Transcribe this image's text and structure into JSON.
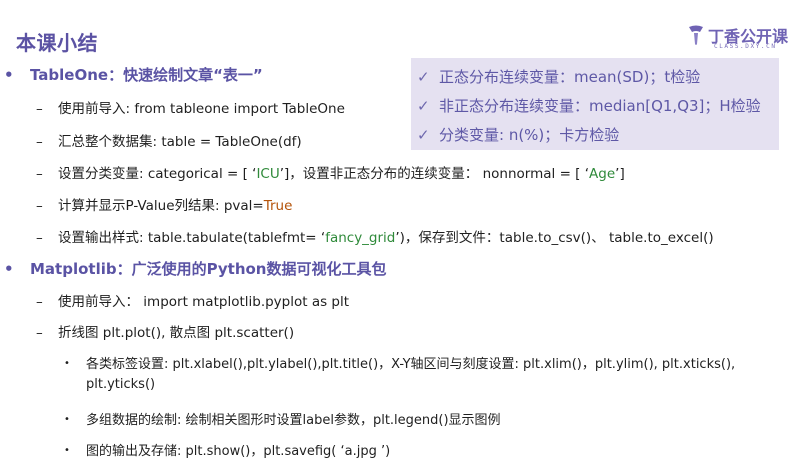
{
  "title": "本课小结",
  "logo": {
    "name": "丁香公开课",
    "sub": "CLASS.DXY.CN"
  },
  "highlight_box": [
    {
      "check": "✓",
      "text": "正态分布连续变量：mean(SD)；t检验"
    },
    {
      "check": "✓",
      "text": "非正态分布连续变量：median[Q1,Q3]；H检验"
    },
    {
      "check": "✓",
      "text": "分类变量: n(%)；卡方检验"
    }
  ],
  "section1": {
    "bullet": "•",
    "title": "TableOne：快速绘制文章“表一”",
    "items": {
      "import": "使用前导入: from tableone import TableOne",
      "summary": "汇总整个数据集: table = TableOne(df)",
      "categorical_prefix": "设置分类变量: categorical = [ ‘",
      "categorical_value": "ICU",
      "categorical_mid": "’]，设置非正态分布的连续变量： nonnormal = [ ‘",
      "nonnormal_value": "Age",
      "nonnormal_suffix": "’]",
      "pval_prefix": "计算并显示P-Value列结果: pval=",
      "pval_value": "True",
      "tabulate_prefix": "设置输出样式: table.tabulate(tablefmt= ‘",
      "tabulate_value": "fancy_grid",
      "tabulate_suffix": "’)，保存到文件：table.to_csv()、 table.to_excel()"
    }
  },
  "section2": {
    "bullet": "•",
    "title": "Matplotlib：广泛使用的Python数据可视化工具包",
    "items": {
      "import": "使用前导入： import matplotlib.pyplot as plt",
      "plots": "折线图 plt.plot(), 散点图 plt.scatter()",
      "sub1_line1": "各类标签设置: plt.xlabel(),plt.ylabel(),plt.title()，X-Y轴区间与刻度设置: plt.xlim()，plt.ylim(), plt.xticks(),",
      "sub1_line2": "plt.yticks()",
      "sub2": "多组数据的绘制: 绘制相关图形时设置label参数，plt.legend()显示图例",
      "sub3": "图的输出及存储: plt.show()，plt.savefig( ‘a.jpg ’)"
    }
  },
  "dash": "–",
  "subdot": "•"
}
